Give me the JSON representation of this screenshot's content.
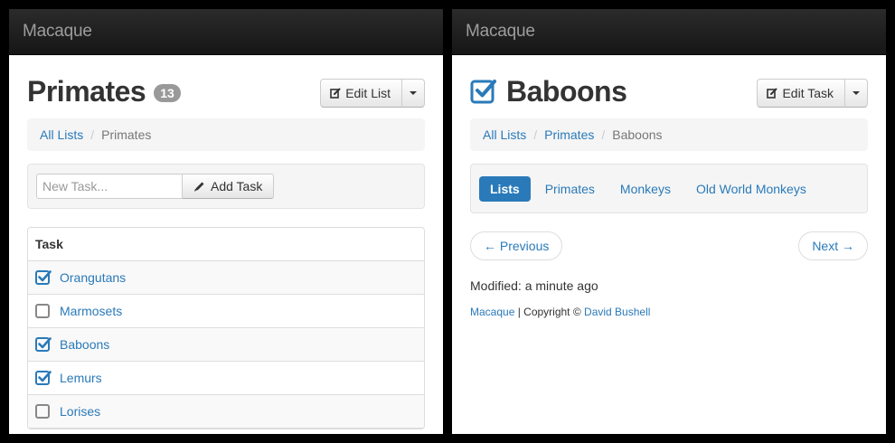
{
  "colors": {
    "accent": "#2a7ab9",
    "navbar": "#1a1a1a",
    "badge": "#999999"
  },
  "left": {
    "brand": "Macaque",
    "title": "Primates",
    "count": "13",
    "edit_button": "Edit List",
    "edit_icon": "edit-icon",
    "breadcrumb": {
      "root": "All Lists",
      "sep": "/",
      "current": "Primates"
    },
    "new_task_placeholder": "New Task...",
    "add_task_button": "Add Task",
    "add_task_icon": "pencil-icon",
    "table_header": "Task",
    "tasks": [
      {
        "label": "Orangutans",
        "checked": true
      },
      {
        "label": "Marmosets",
        "checked": false
      },
      {
        "label": "Baboons",
        "checked": true
      },
      {
        "label": "Lemurs",
        "checked": true
      },
      {
        "label": "Lorises",
        "checked": false
      }
    ]
  },
  "right": {
    "brand": "Macaque",
    "title": "Baboons",
    "title_icon": "checked-checkbox-icon",
    "edit_button": "Edit Task",
    "breadcrumb": {
      "root": "All Lists",
      "sep": "/",
      "middle": "Primates",
      "current": "Baboons"
    },
    "pills": [
      "Lists",
      "Primates",
      "Monkeys",
      "Old World Monkeys"
    ],
    "active_pill": "Lists",
    "prev_button": "← Previous",
    "next_button": "Next →",
    "modified": "Modified: a minute ago",
    "footer": {
      "brand_link": "Macaque",
      "divider": " | Copyright © ",
      "author_link": "David Bushell"
    }
  }
}
